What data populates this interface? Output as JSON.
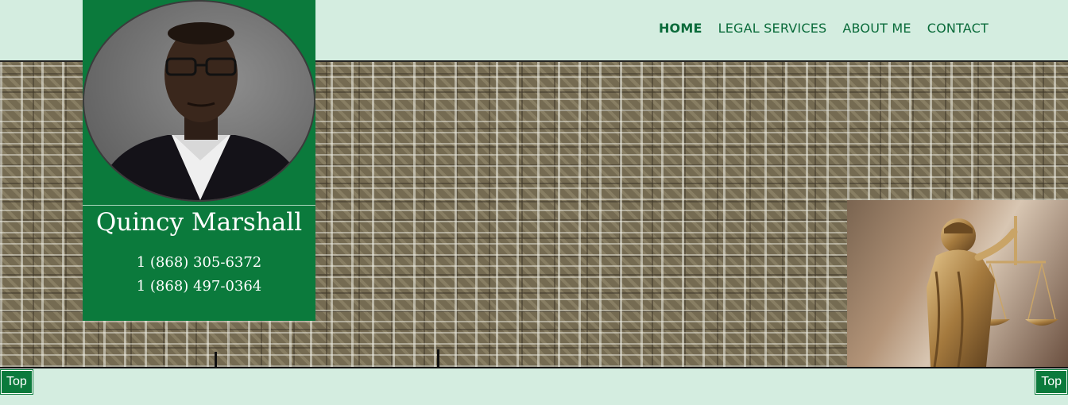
{
  "nav": {
    "items": [
      {
        "label": "HOME",
        "active": true
      },
      {
        "label": "LEGAL SERVICES",
        "active": false
      },
      {
        "label": "ABOUT ME",
        "active": false
      },
      {
        "label": "CONTACT",
        "active": false
      }
    ]
  },
  "profile": {
    "name": "Quincy Marshall",
    "phone_1": "1 (868) 305-6372",
    "phone_2": "1 (868) 497-0364"
  },
  "buttons": {
    "top_left_label": "Top",
    "top_right_label": "Top"
  },
  "colors": {
    "page_background": "#d4ede0",
    "brand_green": "#0b7a3c",
    "nav_text": "#0a6b3a"
  }
}
